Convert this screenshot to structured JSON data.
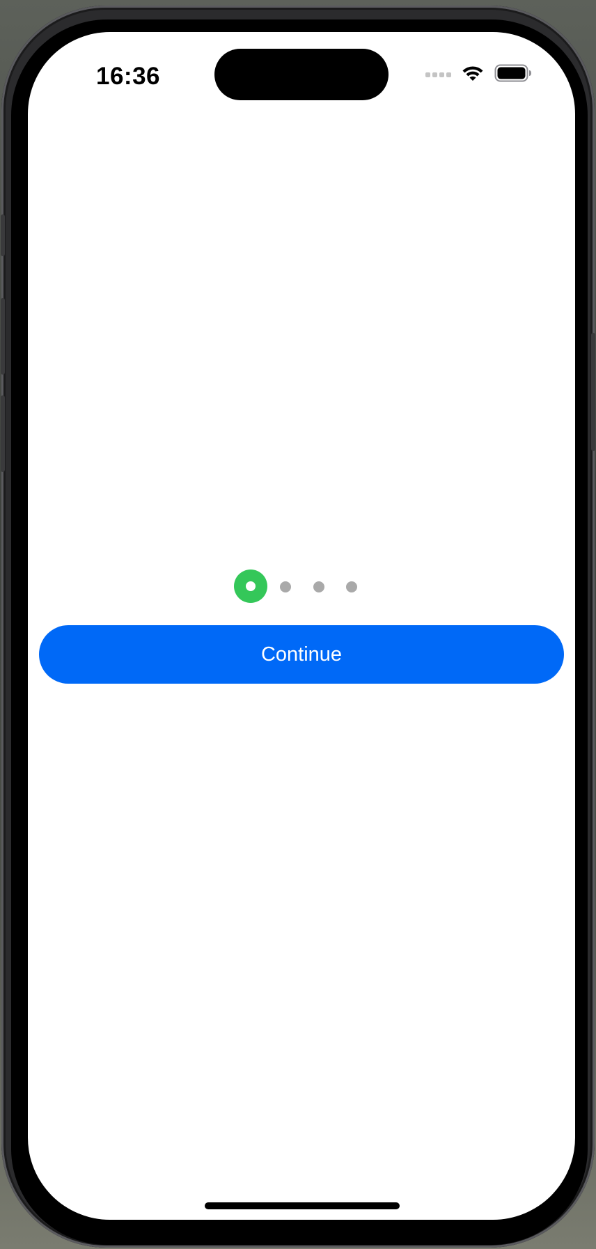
{
  "status_bar": {
    "time": "16:36",
    "wifi_icon": "wifi-icon",
    "battery_icon": "battery-icon",
    "signal_icon": "cellular-signal-icon"
  },
  "onboarding": {
    "page_indicator": {
      "total_pages": 4,
      "current_page": 1,
      "active_color": "#34c759",
      "inactive_color": "#a9a9a9"
    },
    "continue_label": "Continue",
    "continue_color": "#0069f7"
  }
}
